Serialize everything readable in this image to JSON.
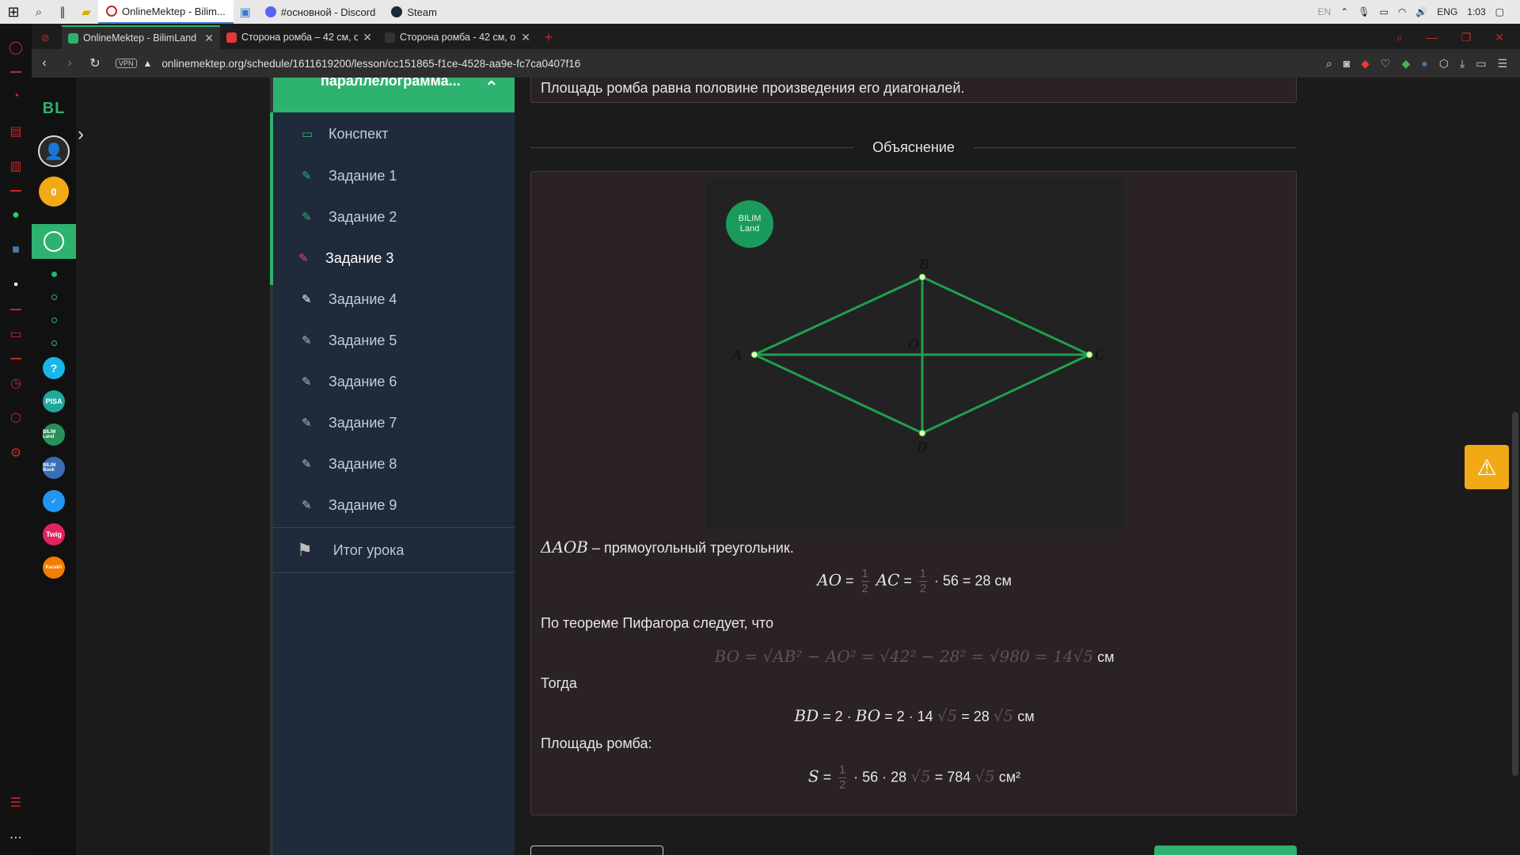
{
  "taskbar": {
    "apps": [
      {
        "label": "OnlineMektep - Bilim..."
      },
      {
        "label": "#основной - Discord"
      },
      {
        "label": "Steam"
      }
    ],
    "tray": {
      "lang_small": "EN",
      "lang": "ENG",
      "time": "1:03"
    }
  },
  "tabs": [
    {
      "label": "OnlineMektep - BilimLand"
    },
    {
      "label": "Сторона ромба – 42 см, о"
    },
    {
      "label": "Сторона ромба - 42 см, о"
    }
  ],
  "address": {
    "vpn": "VPN",
    "url": "onlinemektep.org/schedule/1611619200/lesson/cc151865-f1ce-4528-aa9e-fc7ca0407f16"
  },
  "rail": {
    "logo": "BL",
    "coins": "0",
    "app_labels": [
      "?",
      "PISA",
      "BILIM Land",
      "BILIM Book",
      "",
      "Twig",
      "Kazakh"
    ]
  },
  "sidebar": {
    "header": "параллелограмма...",
    "items": [
      {
        "label": "Конспект"
      },
      {
        "label": "Задание 1"
      },
      {
        "label": "Задание 2"
      },
      {
        "label": "Задание 3"
      },
      {
        "label": "Задание 4"
      },
      {
        "label": "Задание 5"
      },
      {
        "label": "Задание 6"
      },
      {
        "label": "Задание 7"
      },
      {
        "label": "Задание 8"
      },
      {
        "label": "Задание 9"
      }
    ],
    "summary": "Итог урока"
  },
  "content": {
    "note": "Площадь ромба равна половине произведения его диагоналей.",
    "section_title": "Объяснение",
    "figure": {
      "badge_top": "BILIM",
      "badge_bottom": "Land",
      "points": {
        "A": "A",
        "B": "B",
        "C": "C",
        "D": "D",
        "O": "O"
      }
    },
    "line1_math": "ΔAOB",
    "line1_text": "– прямоугольный треугольник.",
    "f1": {
      "lhs": "AO",
      "eq": "=",
      "ac": "AC",
      "rest": "· 56 = 28 см"
    },
    "line2": "По теореме Пифагора следует, что",
    "f2": {
      "expr": "BO = √AB² − AO² = √42² − 28² = √980 = 14√5",
      "unit": "см"
    },
    "line3": "Тогда",
    "f3": {
      "lhs": "BD",
      "mid": "= 2 ·",
      "bo": "BO",
      "rest1": "= 2 · 14",
      "rest2": "= 28",
      "unit": "см"
    },
    "line4": "Площадь ромба:",
    "f4": {
      "lhs": "S",
      "rest1": "· 56 · 28",
      "rest2": "= 784",
      "unit": "см²"
    },
    "frac_num": "1",
    "frac_den": "2",
    "sqrt5": "√5"
  }
}
